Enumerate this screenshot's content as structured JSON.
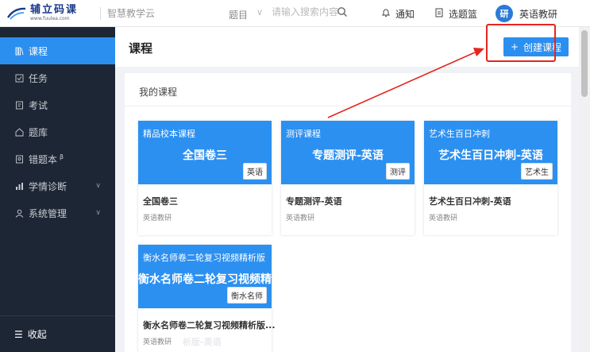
{
  "header": {
    "logo_text": "辅立码课",
    "logo_url": "www.fuulea.com",
    "platform": "智慧教学云",
    "topic_label": "题目",
    "search_placeholder": "请输入搜索内容",
    "notify_label": "通知",
    "basket_label": "选题篮",
    "avatar_text": "研",
    "user_name": "英语教研"
  },
  "sidebar": {
    "items": [
      {
        "label": "课程",
        "icon": "course-icon",
        "active": true
      },
      {
        "label": "任务",
        "icon": "task-icon"
      },
      {
        "label": "考试",
        "icon": "exam-icon"
      },
      {
        "label": "题库",
        "icon": "question-bank-icon"
      },
      {
        "label": "错题本",
        "badge": "β",
        "icon": "wrong-book-icon"
      },
      {
        "label": "学情诊断",
        "icon": "diagnosis-icon",
        "expandable": true
      },
      {
        "label": "系统管理",
        "icon": "system-icon",
        "expandable": true
      }
    ],
    "collapse_label": "收起"
  },
  "page": {
    "title": "课程",
    "create_button": "创建课程",
    "panel_title": "我的课程"
  },
  "courses": [
    {
      "sub": "精品校本课程",
      "big": "全国卷三",
      "tag": "英语",
      "name": "全国卷三",
      "author": "英语教研"
    },
    {
      "sub": "测评课程",
      "big": "专题测评-英语",
      "tag": "测评",
      "name": "专题测评-英语",
      "author": "英语教研"
    },
    {
      "sub": "艺术生百日冲刺",
      "big": "艺术生百日冲刺-英语",
      "tag": "艺术生",
      "name": "艺术生百日冲刺-英语",
      "author": "英语教研"
    },
    {
      "sub": "衡水名师卷二轮复习视频精析版",
      "big": "衡水名师卷二轮复习视频精",
      "tag": "衡水名师",
      "name": "衡水名师卷二轮复习视频精析版...",
      "author": "英语教研",
      "ghost": "析版-英语"
    }
  ],
  "colors": {
    "accent": "#2b8ff0",
    "sidebar_bg": "#1d2634",
    "highlight": "#e3261e"
  }
}
